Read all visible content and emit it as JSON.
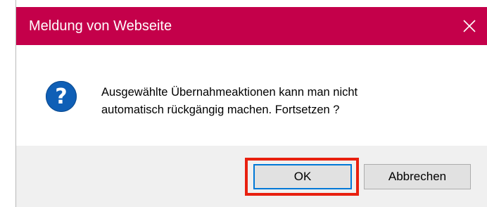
{
  "dialog": {
    "title": "Meldung von Webseite",
    "close_icon": "close-icon",
    "accent_color": "#c4004a",
    "message_icon": "question-icon",
    "message_icon_glyph": "?",
    "message_line1": "Ausgewählte Übernahmeaktionen kann man nicht",
    "message_line2": "automatisch rückgängig machen. Fortsetzen ?",
    "buttons": {
      "ok_label": "OK",
      "cancel_label": "Abbrechen"
    },
    "highlight_color": "#e8200f"
  }
}
